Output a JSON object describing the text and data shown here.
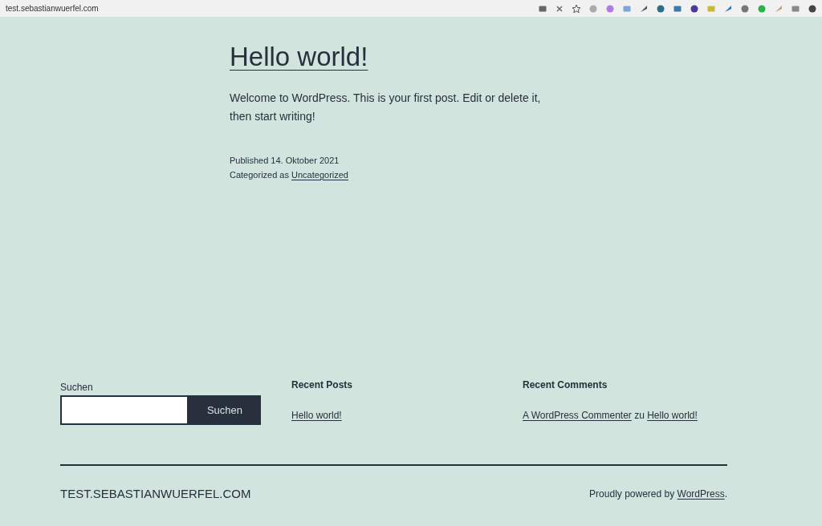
{
  "browser": {
    "url": "test.sebastianwuerfel.com"
  },
  "post": {
    "title": "Hello world!",
    "content": "Welcome to WordPress. This is your first post. Edit or delete it, then start writing!",
    "published": "Published 14. Oktober 2021",
    "category_prefix": "Categorized as",
    "category": "Uncategorized"
  },
  "search": {
    "label": "Suchen",
    "button": "Suchen"
  },
  "recent_posts": {
    "heading": "Recent Posts",
    "items": [
      "Hello world!"
    ]
  },
  "recent_comments": {
    "heading": "Recent Comments",
    "items": [
      {
        "author": "A WordPress Commenter",
        "connector": "zu",
        "post": "Hello world!"
      }
    ]
  },
  "footer": {
    "site_title": "TEST.SEBASTIANWUERFEL.COM",
    "powered_prefix": "Proudly powered by",
    "powered_link": "WordPress",
    "powered_suffix": "."
  }
}
